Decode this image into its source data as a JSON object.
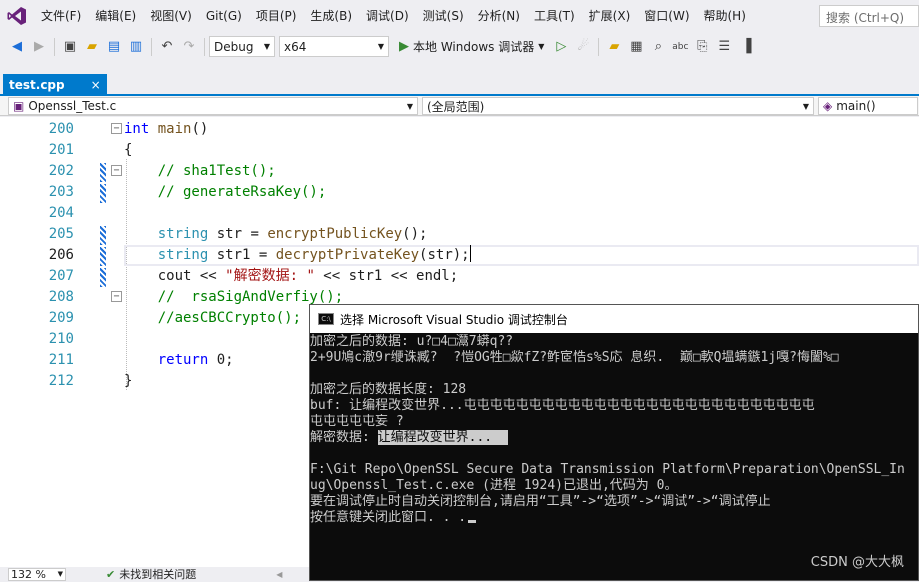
{
  "menu": {
    "items": [
      "文件(F)",
      "编辑(E)",
      "视图(V)",
      "Git(G)",
      "项目(P)",
      "生成(B)",
      "调试(D)",
      "测试(S)",
      "分析(N)",
      "工具(T)",
      "扩展(X)",
      "窗口(W)",
      "帮助(H)"
    ],
    "search_placeholder": "搜索 (Ctrl+Q)"
  },
  "toolbar": {
    "config": "Debug",
    "platform": "x64",
    "run_label": "本地 Windows 调试器"
  },
  "tab": {
    "label": "test.cpp",
    "close": "×"
  },
  "navbar": {
    "project": "Openssl_Test.c",
    "scope": "(全局范围)",
    "member": "main()"
  },
  "editor": {
    "lines": [
      {
        "num": "200",
        "tokens": [
          {
            "t": "int",
            "c": "kw"
          },
          {
            "t": " ",
            "c": ""
          },
          {
            "t": "main",
            "c": "fn"
          },
          {
            "t": "()",
            "c": ""
          }
        ]
      },
      {
        "num": "201",
        "tokens": [
          {
            "t": "{",
            "c": ""
          }
        ]
      },
      {
        "num": "202",
        "tokens": [
          {
            "t": "    // sha1Test();",
            "c": "cm"
          }
        ]
      },
      {
        "num": "203",
        "tokens": [
          {
            "t": "    // generateRsaKey();",
            "c": "cm"
          }
        ]
      },
      {
        "num": "204",
        "tokens": []
      },
      {
        "num": "205",
        "tokens": [
          {
            "t": "    ",
            "c": ""
          },
          {
            "t": "string",
            "c": "ty"
          },
          {
            "t": " str = ",
            "c": ""
          },
          {
            "t": "encryptPublicKey",
            "c": "fn"
          },
          {
            "t": "();",
            "c": ""
          }
        ]
      },
      {
        "num": "206",
        "tokens": [
          {
            "t": "    ",
            "c": ""
          },
          {
            "t": "string",
            "c": "ty"
          },
          {
            "t": " str1 = ",
            "c": ""
          },
          {
            "t": "decryptPrivateKey",
            "c": "fn"
          },
          {
            "t": "(str);",
            "c": ""
          }
        ]
      },
      {
        "num": "207",
        "tokens": [
          {
            "t": "    cout << ",
            "c": ""
          },
          {
            "t": "\"解密数据: \"",
            "c": "str"
          },
          {
            "t": " << str1 << endl;",
            "c": ""
          }
        ]
      },
      {
        "num": "208",
        "tokens": [
          {
            "t": "    //  rsaSigAndVerfiy();",
            "c": "cm"
          }
        ]
      },
      {
        "num": "209",
        "tokens": [
          {
            "t": "    //aesCBCCrypto();",
            "c": "cm"
          }
        ]
      },
      {
        "num": "210",
        "tokens": []
      },
      {
        "num": "211",
        "tokens": [
          {
            "t": "    ",
            "c": ""
          },
          {
            "t": "return",
            "c": "kw"
          },
          {
            "t": " 0;",
            "c": ""
          }
        ]
      },
      {
        "num": "212",
        "tokens": [
          {
            "t": "}",
            "c": ""
          }
        ]
      }
    ]
  },
  "status": {
    "zoom": "132 %",
    "issues": "未找到相关问题"
  },
  "console": {
    "title": "选择 Microsoft Visual Studio 调试控制台",
    "lines": [
      "加密之后的数据: u?□4□灊7蟒q??",
      "2+9U鳩c澈9r缏诛臧?  ?愷OG牲□歘fZ?鲊宧悎s%S応 息织.  巅□軟Q塭螨鏃1j嘎?悔闔%□",
      "",
      "加密之后的数据长度: 128",
      "buf: 让编程改变世界...屯屯屯屯屯屯屯屯屯屯屯屯屯屯屯屯屯屯屯屯屯屯屯屯屯屯屯",
      "屯屯屯屯屯妄 ?",
      "",
      "",
      "F:\\Git Repo\\OpenSSL Secure Data Transmission Platform\\Preparation\\OpenSSL_In",
      "ug\\Openssl_Test.c.exe (进程 1924)已退出,代码为 0。",
      "要在调试停止时自动关闭控制台,请启用“工具”->“选项”->“调试”->“调试停止",
      "按任意键关闭此窗口. . ."
    ],
    "label_prefix": "解密数据: ",
    "label_value": "让编程改变世界...  "
  },
  "watermark": "CSDN @大大枫"
}
